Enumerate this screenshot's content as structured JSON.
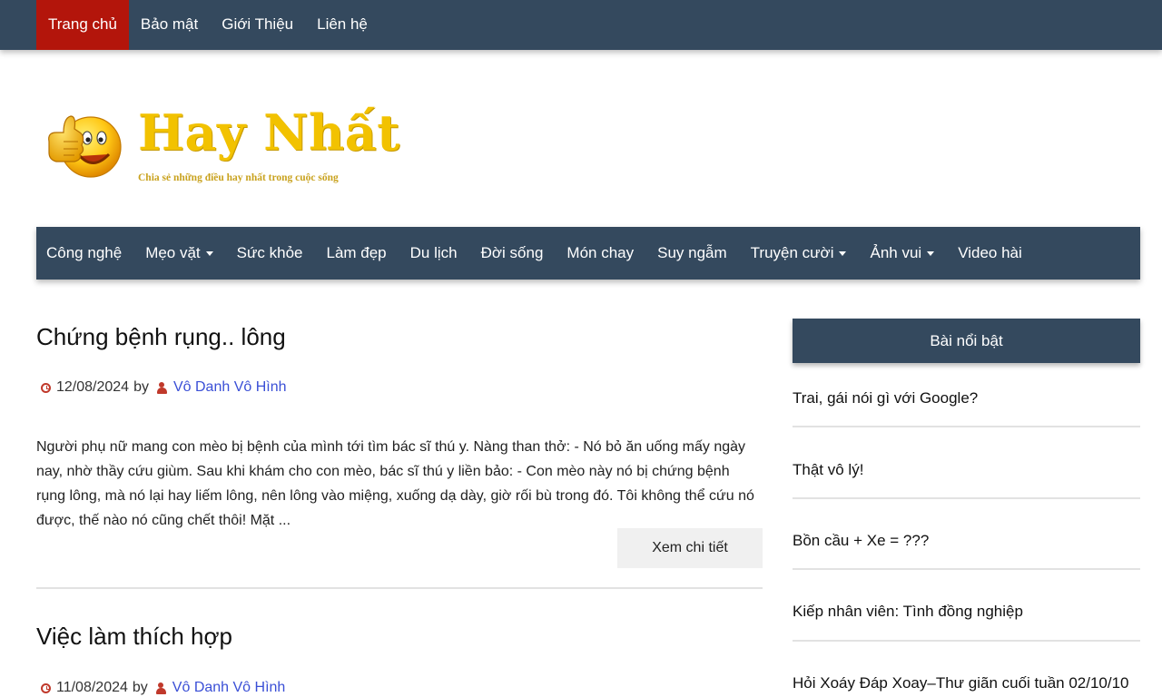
{
  "topnav": {
    "items": [
      "Trang chủ",
      "Bảo mật",
      "Giới Thiệu",
      "Liên hệ"
    ]
  },
  "logo": {
    "title": "Hay Nhất",
    "tagline": "Chia sẻ những điều hay nhất trong cuộc sống"
  },
  "mainnav": {
    "items": [
      {
        "label": "Công nghệ"
      },
      {
        "label": "Mẹo vặt"
      },
      {
        "label": "Sức khỏe"
      },
      {
        "label": "Làm đẹp"
      },
      {
        "label": "Du lịch"
      },
      {
        "label": "Đời sống"
      },
      {
        "label": "Món chay"
      },
      {
        "label": "Suy ngẫm"
      },
      {
        "label": "Truyện cười"
      },
      {
        "label": "Ảnh vui"
      },
      {
        "label": "Video hài"
      }
    ]
  },
  "posts": [
    {
      "title": "Chứng bệnh rụng.. lông",
      "date": "12/08/2024",
      "by": "by",
      "author": "Vô Danh Vô Hình",
      "excerpt": "Người phụ nữ mang con mèo bị bệnh của mình tới tìm bác sĩ thú y. Nàng than thở: - Nó bỏ ăn uống mấy ngày nay, nhờ thầy cứu giùm. Sau khi khám cho con mèo, bác sĩ thú y liền bảo: - Con mèo này nó bị chứng bệnh rụng lông, mà nó lại hay liếm lông, nên lông vào miệng, xuống dạ dày, giờ rối bù trong đó. Tôi không thể cứu nó được, thế nào nó cũng chết thôi! Mặt ...",
      "more": "Xem chi tiết"
    },
    {
      "title": "Việc làm thích hợp",
      "date": "11/08/2024",
      "by": "by",
      "author": "Vô Danh Vô Hình"
    }
  ],
  "sidebar": {
    "title": "Bài nổi bật",
    "items": [
      "Trai, gái nói gì với Google?",
      "Thật vô lý!",
      "Bồn cầu + Xe = ???",
      "Kiếp nhân viên: Tình đồng nghiệp",
      "Hỏi Xoáy Đáp Xoay–Thư giãn cuối tuần 02/10/10"
    ]
  },
  "colors": {
    "nav_bg": "#34495e",
    "active_tab": "#b3150b",
    "logo_yellow": "#f2c200",
    "author_link": "#3a4fd6",
    "meta_icon": "#c0392b"
  }
}
